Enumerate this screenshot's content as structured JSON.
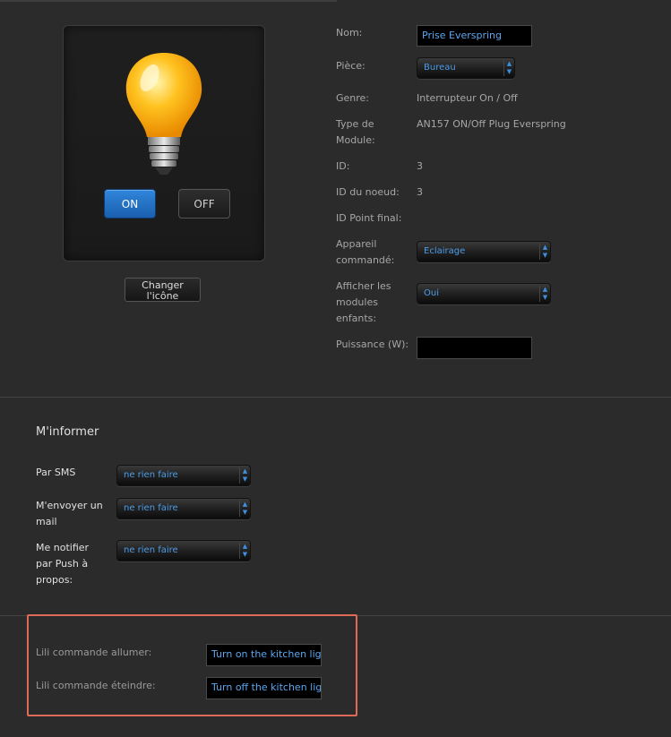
{
  "device": {
    "on_label": "ON",
    "off_label": "OFF",
    "change_icon_label": "Changer l'icône"
  },
  "fields": {
    "nom_label": "Nom:",
    "nom_value": "Prise Everspring",
    "piece_label": "Pièce:",
    "piece_value": "Bureau",
    "genre_label": "Genre:",
    "genre_value": "Interrupteur On / Off",
    "type_label": "Type de Module:",
    "type_value": "AN157 ON/Off Plug Everspring",
    "id_label": "ID:",
    "id_value": "3",
    "noeud_label": "ID du noeud:",
    "noeud_value": "3",
    "point_label": "ID Point final:",
    "appareil_label": "Appareil commandé:",
    "appareil_value": "Eclairage",
    "afficher_label": "Afficher les modules enfants:",
    "afficher_value": "Oui",
    "puissance_label": "Puissance (W):",
    "puissance_value": ""
  },
  "inform": {
    "title": "M'informer",
    "sms_label": "Par SMS",
    "sms_value": "ne rien faire",
    "mail_label": "M'envoyer un mail",
    "mail_value": "ne rien faire",
    "push_label": "Me notifier par Push à propos:",
    "push_value": "ne rien faire"
  },
  "lili": {
    "on_label": "Lili commande allumer:",
    "on_value": "Turn on the kitchen lig",
    "off_label": "Lili commande éteindre:",
    "off_value": "Turn off the kitchen lig"
  },
  "colors": {
    "accent_blue": "#2f86dc",
    "highlight": "#e06a58",
    "input_text": "#5aa7ef"
  }
}
